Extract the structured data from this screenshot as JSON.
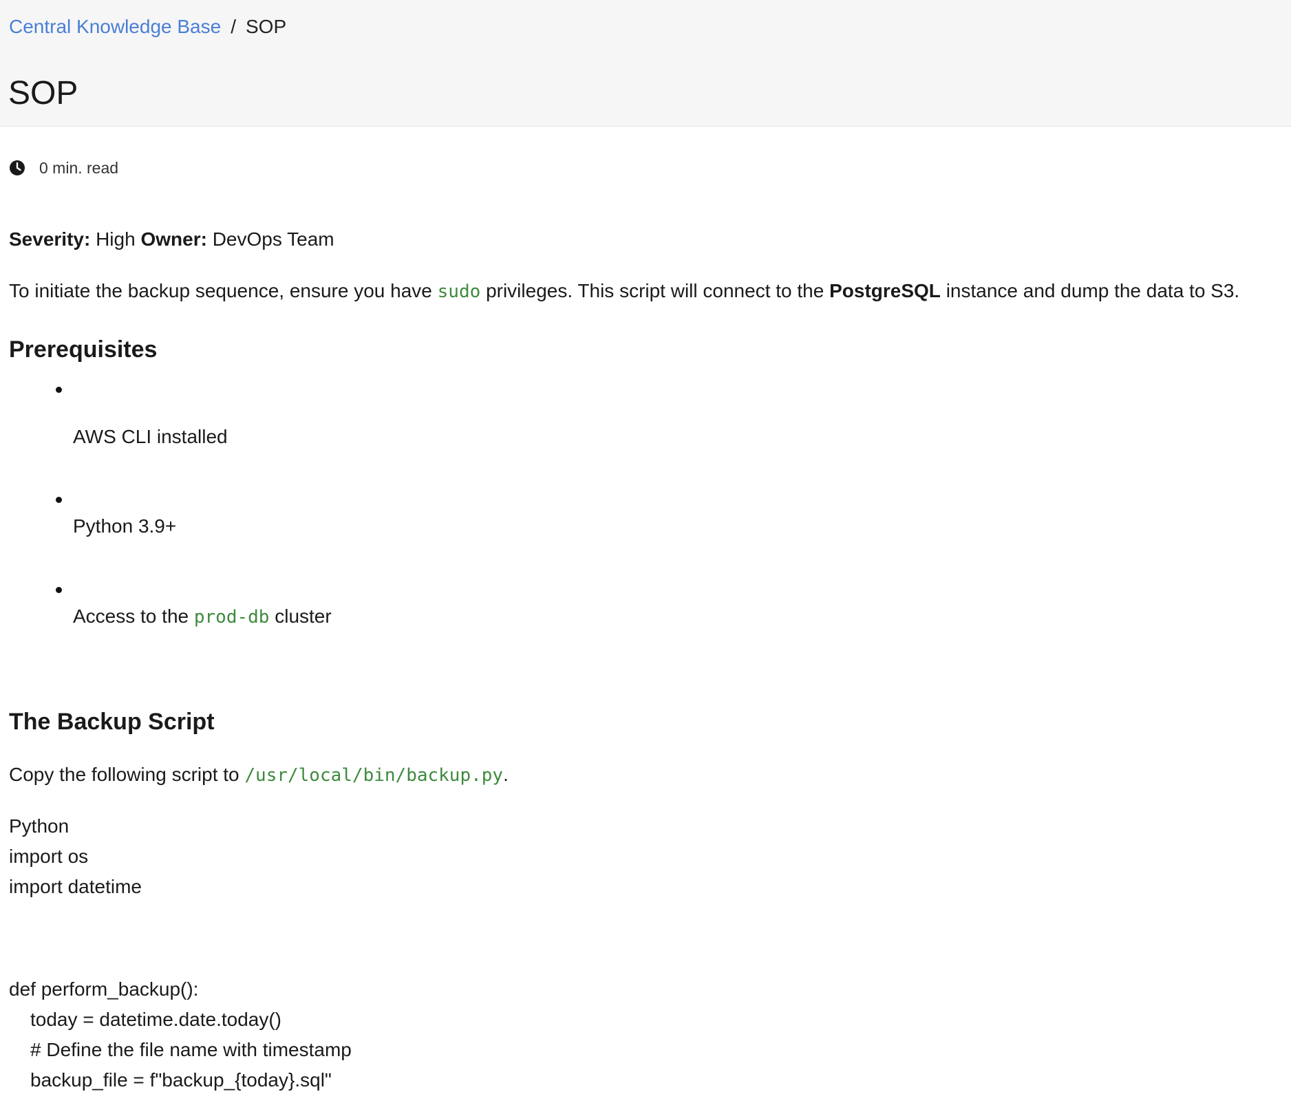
{
  "breadcrumb": {
    "link": "Central Knowledge Base",
    "separator": "/",
    "current": "SOP"
  },
  "page": {
    "title": "SOP",
    "read_time": "0 min. read"
  },
  "meta_line": {
    "severity_label": "Severity:",
    "severity_value": "High",
    "owner_label": "Owner:",
    "owner_value": "DevOps Team"
  },
  "intro": {
    "part1": "To initiate the backup sequence, ensure you have",
    "code1": "sudo",
    "part2": "privileges. This script will connect to the",
    "bold1": "PostgreSQL",
    "part3": "instance and dump the data to S3."
  },
  "prerequisites": {
    "heading": "Prerequisites",
    "items": [
      {
        "text": "AWS CLI installed"
      },
      {
        "text": "Python 3.9+"
      },
      {
        "text_before": "Access to the",
        "code": "prod-db",
        "text_after": "cluster"
      }
    ]
  },
  "backup_script": {
    "heading": "The Backup Script",
    "copy_text": "Copy the following script to",
    "path": "/usr/local/bin/backup.py",
    "period": ".",
    "language": "Python",
    "lines": [
      "import os",
      "import datetime",
      "def perform_backup():",
      "today = datetime.date.today()",
      "# Define the file name with timestamp",
      "backup_file = f\"backup_{today}.sql\""
    ]
  },
  "colors": {
    "link": "#4a7fd6",
    "code": "#3d8a3d",
    "header_bg": "#f6f6f6"
  },
  "icons": {
    "read_time": "clock-icon"
  }
}
